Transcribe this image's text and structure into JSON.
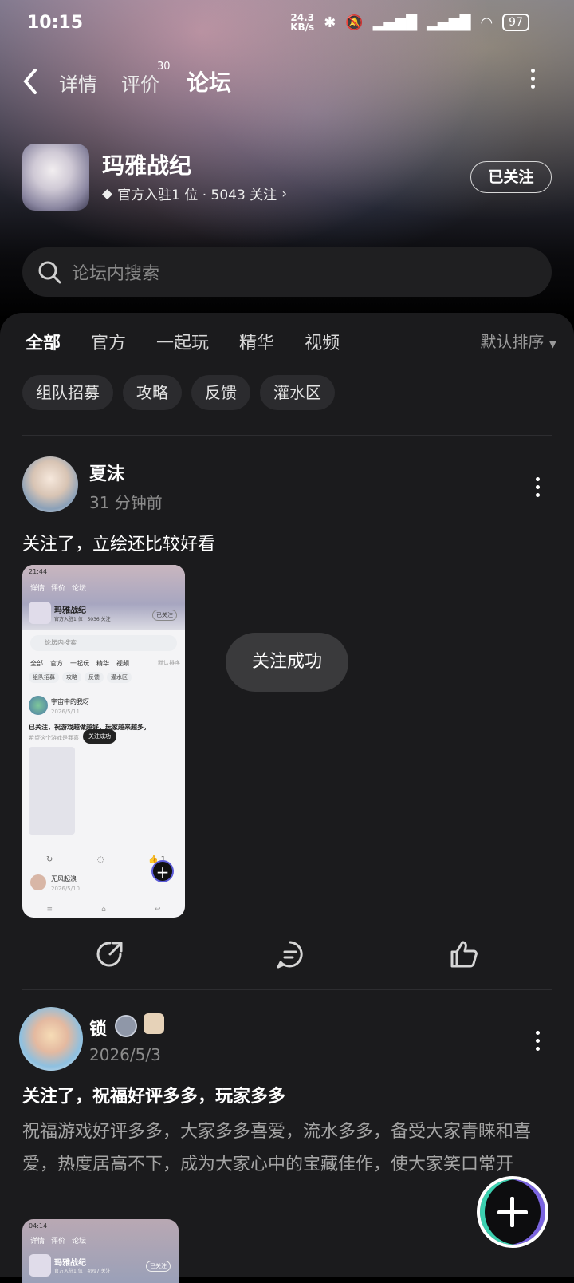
{
  "status_bar": {
    "time": "10:15",
    "speed_value": "24.3",
    "speed_unit": "KB/s",
    "battery": "97"
  },
  "header": {
    "tabs": [
      {
        "label": "详情"
      },
      {
        "label": "评价",
        "count": "30"
      },
      {
        "label": "论坛"
      }
    ],
    "game": {
      "name": "玛雅战纪",
      "meta": "官方入驻1 位 · 5043 关注",
      "follow_label": "已关注"
    }
  },
  "search": {
    "placeholder": "论坛内搜索"
  },
  "forum": {
    "tabs": [
      "全部",
      "官方",
      "一起玩",
      "精华",
      "视频"
    ],
    "sort": "默认排序",
    "chips": [
      "组队招募",
      "攻略",
      "反馈",
      "灌水区"
    ]
  },
  "toast": "关注成功",
  "posts": [
    {
      "user": "夏沫",
      "time": "31 分钟前",
      "text": "关注了，立绘还比较好看",
      "screenshot": {
        "status_time": "21:44",
        "nav": [
          "详情",
          "评价",
          "论坛"
        ],
        "game_name": "玛雅战纪",
        "game_sub": "官方入驻1 位 · 5036 关注",
        "follow": "已关注",
        "search": "论坛内搜索",
        "tabs": [
          "全部",
          "官方",
          "一起玩",
          "精华",
          "视频"
        ],
        "sort": "默认排序",
        "chips": [
          "组队招募",
          "攻略",
          "反馈",
          "灌水区"
        ],
        "user": "宇宙中的我呀",
        "date": "2026/5/11",
        "text": "已关注，祝游戏越做越好，玩家越来越多。",
        "text2": "希望这个游戏是我喜",
        "toast": "关注成功",
        "like_count": "1",
        "user2": "无风起浪",
        "date2": "2026/5/10"
      }
    },
    {
      "user": "锁",
      "time": "2026/5/3",
      "title": "关注了，祝福好评多多，玩家多多",
      "text": "祝福游戏好评多多，大家多多喜爱，流水多多，备受大家青睐和喜爱，热度居高不下，成为大家心中的宝藏佳作，使大家笑口常开",
      "screenshot": {
        "status_time": "04:14",
        "nav": [
          "详情",
          "评价",
          "论坛"
        ],
        "game_name": "玛雅战纪",
        "game_sub": "官方入驻1 位 · 4997 关注",
        "follow": "已关注"
      }
    }
  ],
  "icons": {
    "back": "chevron-left-icon",
    "more": "more-vertical-icon",
    "search": "search-icon",
    "share": "share-icon",
    "comment": "comment-icon",
    "like": "like-icon",
    "add": "plus-icon"
  },
  "colors": {
    "accent": "#2dd3b0",
    "panel": "#1b1b1d"
  }
}
